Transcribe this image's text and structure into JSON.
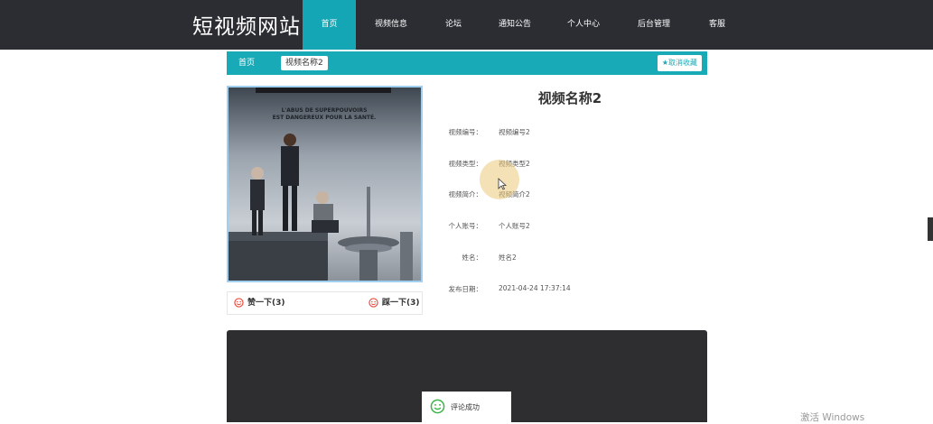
{
  "site": {
    "title": "短视频网站"
  },
  "nav": {
    "items": [
      {
        "label": "首页",
        "active": true
      },
      {
        "label": "视频信息",
        "active": false
      },
      {
        "label": "论坛",
        "active": false
      },
      {
        "label": "通知公告",
        "active": false
      },
      {
        "label": "个人中心",
        "active": false
      },
      {
        "label": "后台管理",
        "active": false
      },
      {
        "label": "客服",
        "active": false
      }
    ]
  },
  "breadcrumb": {
    "home": "首页",
    "current": "视频名称2"
  },
  "favorite": {
    "label": "取消收藏",
    "icon": "star-icon"
  },
  "poster": {
    "text_line1": "L'ABUS DE SUPERPOUVOIRS",
    "text_line2": "EST DANGEREUX POUR LA SANTÉ."
  },
  "votes": {
    "like_label": "赞一下(3)",
    "dislike_label": "踩一下(3)"
  },
  "video": {
    "title": "视频名称2",
    "fields": [
      {
        "label": "视频编号：",
        "value": "视频编号2"
      },
      {
        "label": "视频类型：",
        "value": "视频类型2"
      },
      {
        "label": "视频简介：",
        "value": "视频简介2"
      },
      {
        "label": "个人账号：",
        "value": "个人账号2"
      },
      {
        "label": "姓名：",
        "value": "姓名2"
      },
      {
        "label": "发布日期：",
        "value": "2021-04-24 17:37:14"
      }
    ]
  },
  "toast": {
    "text": "评论成功",
    "icon": "smile-icon"
  },
  "watermark": "激活 Windows",
  "colors": {
    "nav_bg": "#2b2d33",
    "accent": "#18aab6",
    "dark_panel": "#2e2e30"
  }
}
